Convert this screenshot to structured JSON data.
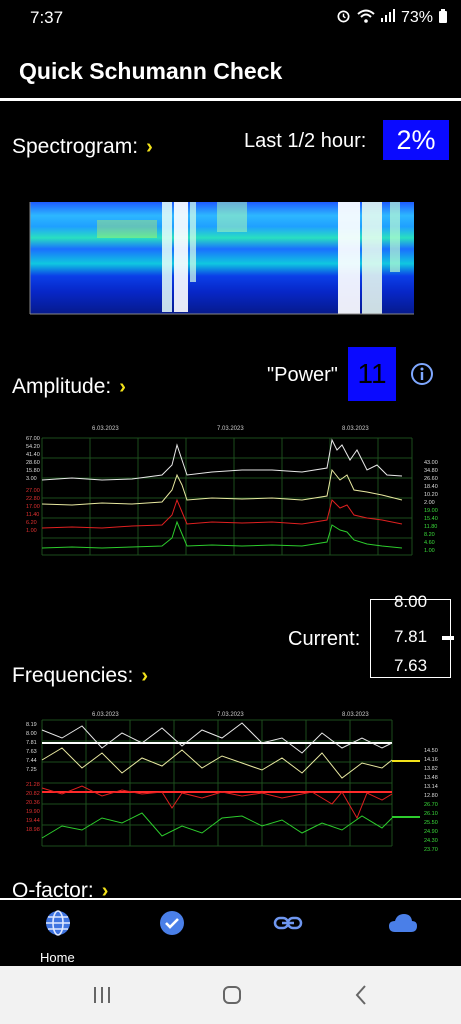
{
  "status": {
    "time": "7:37",
    "battery": "73%"
  },
  "app": {
    "title": "Quick Schumann Check"
  },
  "spectrogram": {
    "label": "Spectrogram:",
    "last_half_hour_label": "Last 1/2 hour:",
    "last_half_hour_value": "2%"
  },
  "amplitude": {
    "label": "Amplitude:",
    "power_label": "\"Power\"",
    "power_value": "11",
    "dates": [
      "6.03.2023",
      "7.03.2023",
      "8.03.2023"
    ],
    "left_ticks_white": [
      "67.00",
      "54.20",
      "41.40",
      "28.60",
      "15.80",
      "3.00"
    ],
    "left_ticks_red": [
      "27.00",
      "22.80",
      "17.00",
      "11.40",
      "6.20",
      "1.00"
    ],
    "right_ticks_white": [
      "43.00",
      "34.80",
      "26.60",
      "18.40",
      "10.20",
      "2.00"
    ],
    "right_ticks_green": [
      "19.00",
      "15.40",
      "11.80",
      "8.20",
      "4.60",
      "1.00"
    ]
  },
  "current": {
    "label": "Current:",
    "values": [
      "8.00",
      "7.81",
      "7.63"
    ]
  },
  "frequencies": {
    "label": "Frequencies:",
    "dates": [
      "6.03.2023",
      "7.03.2023",
      "8.03.2023"
    ],
    "left_ticks": [
      "8.19",
      "8.00",
      "7.81",
      "7.63",
      "7.44",
      "7.25",
      "21.28",
      "20.82",
      "20.36",
      "19.90",
      "19.44",
      "18.98"
    ],
    "right_ticks": [
      "14.50",
      "14.16",
      "13.82",
      "13.48",
      "13.14",
      "12.80",
      "26.70",
      "26.10",
      "25.50",
      "24.90",
      "24.30",
      "23.70"
    ]
  },
  "qfactor": {
    "label": "Q-factor:"
  },
  "nav": {
    "home_label": "Home"
  }
}
